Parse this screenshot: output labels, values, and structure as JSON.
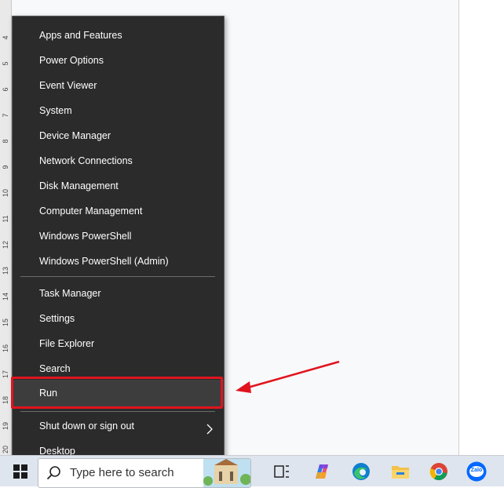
{
  "ruler": {
    "numbers": [
      "4",
      "5",
      "6",
      "7",
      "8",
      "9",
      "10",
      "11",
      "12",
      "13",
      "14",
      "15",
      "16",
      "17",
      "18",
      "19",
      "20"
    ]
  },
  "menu": {
    "group1": [
      {
        "label": "Apps and Features"
      },
      {
        "label": "Power Options"
      },
      {
        "label": "Event Viewer"
      },
      {
        "label": "System"
      },
      {
        "label": "Device Manager"
      },
      {
        "label": "Network Connections"
      },
      {
        "label": "Disk Management"
      },
      {
        "label": "Computer Management"
      },
      {
        "label": "Windows PowerShell"
      },
      {
        "label": "Windows PowerShell (Admin)"
      }
    ],
    "group2": [
      {
        "label": "Task Manager"
      },
      {
        "label": "Settings"
      },
      {
        "label": "File Explorer"
      },
      {
        "label": "Search"
      },
      {
        "label": "Run"
      }
    ],
    "group3": [
      {
        "label": "Shut down or sign out",
        "submenu_icon": "chevron-right-icon"
      },
      {
        "label": "Desktop"
      }
    ],
    "highlighted_item": "Run"
  },
  "annotation": {
    "box_color": "#e0141e",
    "arrow_color": "#e0141e"
  },
  "taskbar": {
    "search_placeholder": "Type here to search",
    "icons": [
      "windows-start-icon",
      "search-icon",
      "task-view-icon",
      "copilot-icon",
      "edge-icon",
      "file-explorer-icon",
      "chrome-icon",
      "zalo-icon"
    ],
    "zalo_label": "Zalo"
  }
}
